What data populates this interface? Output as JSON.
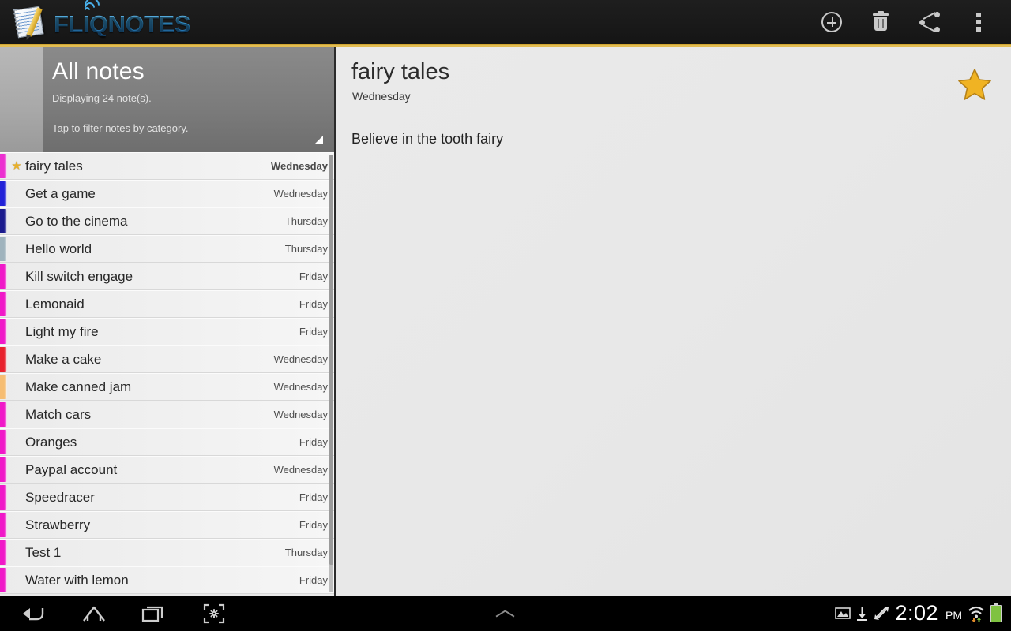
{
  "app": {
    "logo_text": "NOTES",
    "logo_brand": "FLIQ"
  },
  "action_bar": {
    "buttons": [
      {
        "name": "add-note",
        "icon": "plus-circle-icon",
        "label": "New note"
      },
      {
        "name": "delete-note",
        "icon": "trash-icon",
        "label": "Delete"
      },
      {
        "name": "share-note",
        "icon": "share-icon",
        "label": "Share"
      },
      {
        "name": "overflow-menu",
        "icon": "more-vertical-icon",
        "label": "More options"
      }
    ]
  },
  "filter_header": {
    "title": "All notes",
    "subtitle": "Displaying 24 note(s).",
    "hint": "Tap to filter notes by category."
  },
  "note_list": [
    {
      "title": "fairy tales",
      "date": "Wednesday",
      "color": "#ec2fd0",
      "starred": true,
      "selected": true
    },
    {
      "title": "Get a game",
      "date": "Wednesday",
      "color": "#2222d8",
      "starred": false,
      "selected": false
    },
    {
      "title": "Go to the cinema",
      "date": "Thursday",
      "color": "#1b1b8e",
      "starred": false,
      "selected": false
    },
    {
      "title": "Hello world",
      "date": "Thursday",
      "color": "#9fb3bd",
      "starred": false,
      "selected": false
    },
    {
      "title": "Kill switch engage",
      "date": "Friday",
      "color": "#f018c8",
      "starred": false,
      "selected": false
    },
    {
      "title": "Lemonaid",
      "date": "Friday",
      "color": "#f018c8",
      "starred": false,
      "selected": false
    },
    {
      "title": "Light my fire",
      "date": "Friday",
      "color": "#f018c8",
      "starred": false,
      "selected": false
    },
    {
      "title": "Make a cake",
      "date": "Wednesday",
      "color": "#e8212d",
      "starred": false,
      "selected": false
    },
    {
      "title": "Make canned jam",
      "date": "Wednesday",
      "color": "#f6bd72",
      "starred": false,
      "selected": false
    },
    {
      "title": "Match cars",
      "date": "Wednesday",
      "color": "#f018c8",
      "starred": false,
      "selected": false
    },
    {
      "title": "Oranges",
      "date": "Friday",
      "color": "#f018c8",
      "starred": false,
      "selected": false
    },
    {
      "title": "Paypal account",
      "date": "Wednesday",
      "color": "#f018c8",
      "starred": false,
      "selected": false
    },
    {
      "title": "Speedracer",
      "date": "Friday",
      "color": "#f018c8",
      "starred": false,
      "selected": false
    },
    {
      "title": "Strawberry",
      "date": "Friday",
      "color": "#f018c8",
      "starred": false,
      "selected": false
    },
    {
      "title": "Test 1",
      "date": "Thursday",
      "color": "#f018c8",
      "starred": false,
      "selected": false
    },
    {
      "title": "Water with lemon",
      "date": "Friday",
      "color": "#f018c8",
      "starred": false,
      "selected": false
    }
  ],
  "detail": {
    "title": "fairy tales",
    "date": "Wednesday",
    "starred": true,
    "star_color": "#f0b323",
    "body_lines": [
      "Believe in the tooth fairy"
    ]
  },
  "system_bar": {
    "nav": [
      {
        "name": "back-button",
        "icon": "back-arrow-icon"
      },
      {
        "name": "home-button",
        "icon": "home-icon"
      },
      {
        "name": "recents-button",
        "icon": "recent-apps-icon"
      },
      {
        "name": "screenshot-button",
        "icon": "screen-capture-icon"
      }
    ],
    "handle_icon": "chevron-up-icon",
    "status": {
      "icons": [
        "image-icon",
        "download-icon",
        "sync-icon"
      ],
      "time": "2:02",
      "ampm": "PM",
      "wifi_icon": "wifi-icon",
      "battery_icon": "battery-full-icon"
    }
  },
  "theme": {
    "accent_gold": "#d9ab34",
    "brand_blue": "#3aa7e8",
    "bar_dark": "#1a1a1a"
  }
}
